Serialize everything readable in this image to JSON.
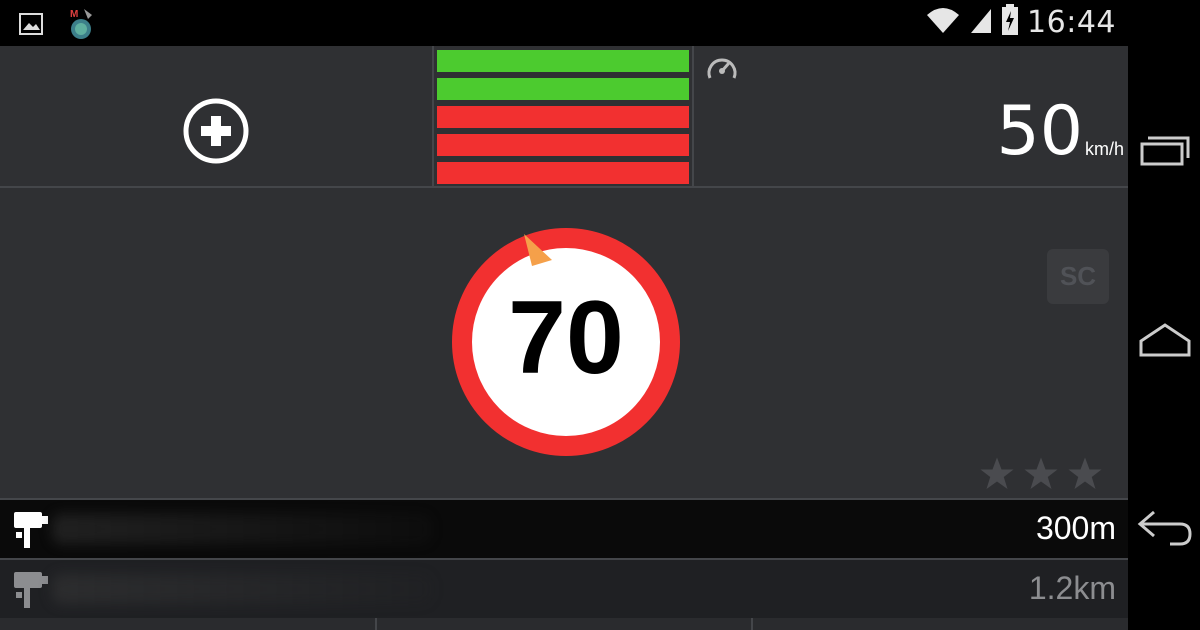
{
  "status_bar": {
    "time": "16:44",
    "icons": [
      "gallery-icon",
      "app-notification-icon",
      "wifi-icon",
      "cell-signal-icon",
      "battery-charging-icon"
    ]
  },
  "top": {
    "add_icon": "plus-circle-icon",
    "speed_bars": [
      "green",
      "green",
      "red",
      "red",
      "red"
    ],
    "gauge_icon": "speedometer-icon",
    "current_speed": "50",
    "speed_unit": "km/h"
  },
  "middle": {
    "speed_limit": "70",
    "sc_badge": "SC",
    "rating_stars": 3
  },
  "alerts": [
    {
      "icon": "speed-camera-icon",
      "distance": "300m"
    },
    {
      "icon": "speed-camera-icon",
      "distance": "1.2km"
    }
  ],
  "colors": {
    "green_bar": "#4ccb2f",
    "red_bar": "#f23030",
    "sign_ring": "#f23030",
    "arrow": "#f5a04a",
    "background": "#2f3033"
  },
  "navigation": {
    "buttons": [
      "recent-apps-icon",
      "home-icon",
      "back-icon"
    ]
  }
}
